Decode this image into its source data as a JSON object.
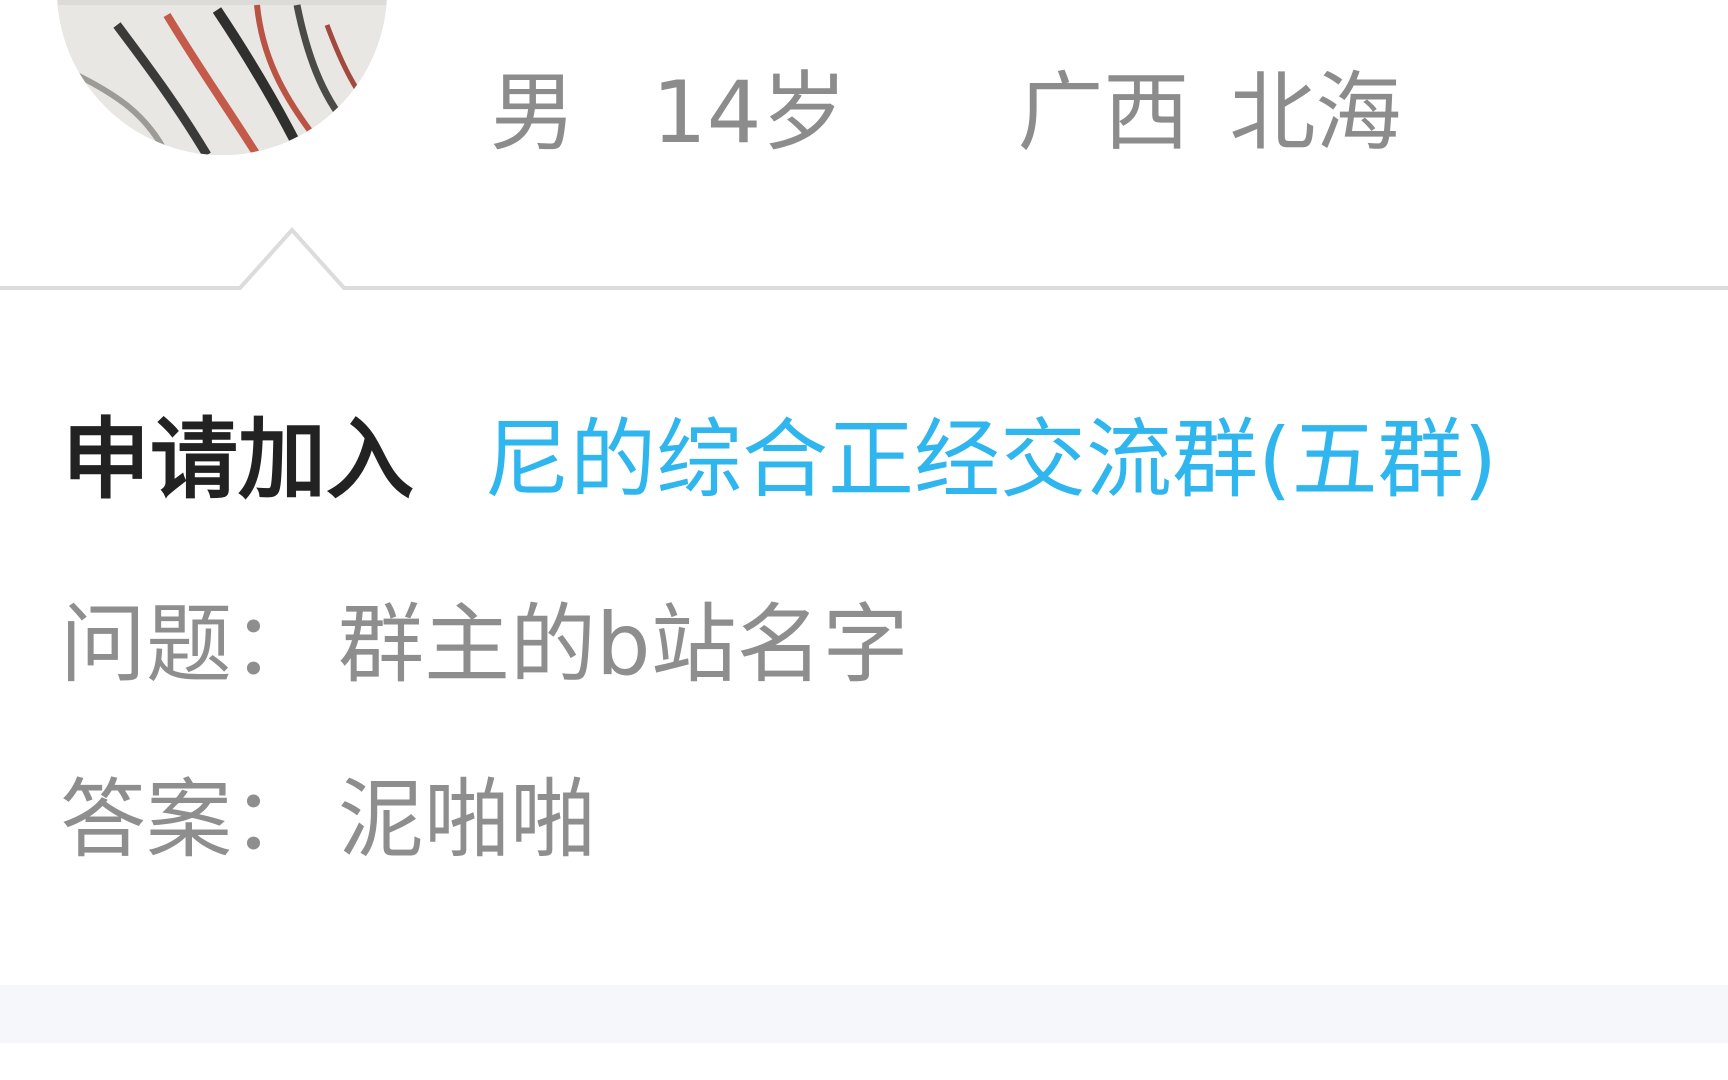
{
  "profile": {
    "gender": "男",
    "age": "14岁",
    "province": "广西",
    "city": "北海"
  },
  "request": {
    "label": "申请加入",
    "group_name": "尼的综合正经交流群(五群)"
  },
  "qa": {
    "question_key": "问题：",
    "question_value": "群主的b站名字",
    "answer_key": "答案：",
    "answer_value": "泥啪啪"
  },
  "colors": {
    "link": "#2fb6ee",
    "label": "#222222",
    "muted": "#8e8e8e",
    "divider": "#dcdcdc",
    "band": "#f6f7fb"
  }
}
